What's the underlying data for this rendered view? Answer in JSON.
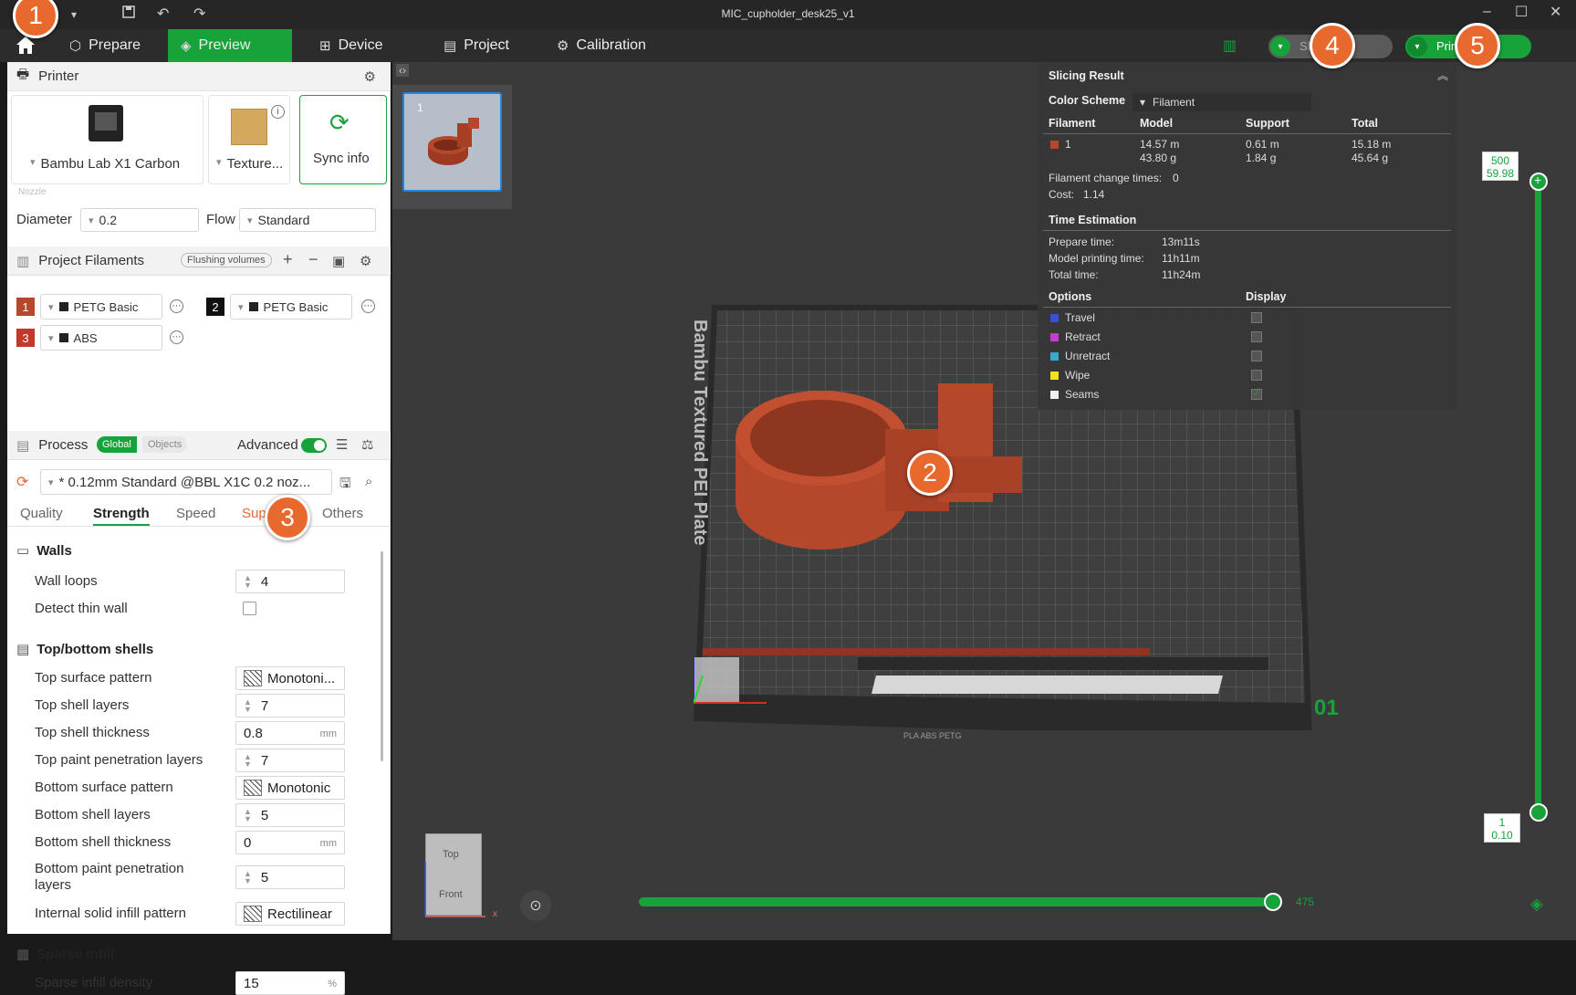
{
  "window": {
    "title": "MIC_cupholder_desk25_v1"
  },
  "nav": {
    "tabs": [
      {
        "label": "Prepare",
        "icon": "cube-icon"
      },
      {
        "label": "Preview",
        "icon": "layers-icon",
        "active": true
      },
      {
        "label": "Device",
        "icon": "device-icon"
      },
      {
        "label": "Project",
        "icon": "project-icon"
      },
      {
        "label": "Calibration",
        "icon": "calibration-icon"
      }
    ],
    "slice_label": "Slice plate",
    "print_label": "Print plate"
  },
  "printer": {
    "section_title": "Printer",
    "model": "Bambu Lab X1 Carbon",
    "plate": "Texture...",
    "sync_label": "Sync info",
    "nozzle_caption": "Nozzle",
    "diameter_label": "Diameter",
    "diameter_value": "0.2",
    "flow_label": "Flow",
    "flow_value": "Standard"
  },
  "filaments": {
    "section_title": "Project Filaments",
    "flushing_label": "Flushing volumes",
    "items": [
      {
        "index": "1",
        "name": "PETG Basic",
        "color": "#b5472a"
      },
      {
        "index": "2",
        "name": "PETG Basic",
        "color": "#111111"
      },
      {
        "index": "3",
        "name": "ABS",
        "color": "#c0392b"
      }
    ]
  },
  "process": {
    "section_title": "Process",
    "global_label": "Global",
    "objects_label": "Objects",
    "advanced_label": "Advanced",
    "preset": "* 0.12mm Standard @BBL X1C 0.2 noz...",
    "tabs": [
      "Quality",
      "Strength",
      "Speed",
      "Support",
      "Others"
    ],
    "active_tab": "Strength",
    "walls": {
      "title": "Walls",
      "wall_loops_label": "Wall loops",
      "wall_loops": "4",
      "detect_thin_wall_label": "Detect thin wall"
    },
    "shells": {
      "title": "Top/bottom shells",
      "rows": [
        {
          "label": "Top surface pattern",
          "value": "Monotoni...",
          "kind": "pattern"
        },
        {
          "label": "Top shell layers",
          "value": "7",
          "kind": "spin"
        },
        {
          "label": "Top shell thickness",
          "value": "0.8",
          "kind": "unit",
          "unit": "mm"
        },
        {
          "label": "Top paint penetration layers",
          "value": "7",
          "kind": "spin"
        },
        {
          "label": "Bottom surface pattern",
          "value": "Monotonic",
          "kind": "pattern"
        },
        {
          "label": "Bottom shell layers",
          "value": "5",
          "kind": "spin"
        },
        {
          "label": "Bottom shell thickness",
          "value": "0",
          "kind": "unit",
          "unit": "mm"
        },
        {
          "label": "Bottom paint penetration layers",
          "value": "5",
          "kind": "spin"
        },
        {
          "label": "Internal solid infill pattern",
          "value": "Rectilinear",
          "kind": "pattern"
        }
      ]
    },
    "infill": {
      "title": "Sparse infill",
      "density_label": "Sparse infill density",
      "density_value": "15",
      "density_unit": "%"
    }
  },
  "viewport": {
    "plate_number": "1",
    "bed_label": "Bambu Textured PEI Plate",
    "plate_id": "01",
    "bed_strip_text": "PLA ABS PETG",
    "view_top": "Top",
    "view_front": "Front",
    "axis_x": "x",
    "layer_top": "500",
    "height_top": "59.98",
    "layer_bottom": "1",
    "height_bottom": "0.10",
    "move_value": "475"
  },
  "slicing_result": {
    "title": "Slicing Result",
    "color_scheme_label": "Color Scheme",
    "color_scheme_value": "Filament",
    "headers": [
      "Filament",
      "Model",
      "Support",
      "Total"
    ],
    "row": {
      "filament": "1",
      "model_len": "14.57 m",
      "model_g": "43.80 g",
      "support_len": "0.61 m",
      "support_g": "1.84 g",
      "total_len": "15.18 m",
      "total_g": "45.64 g",
      "color": "#b5472a"
    },
    "change_times_label": "Filament change times:",
    "change_times": "0",
    "cost_label": "Cost:",
    "cost": "1.14",
    "time_title": "Time Estimation",
    "prepare_label": "Prepare time:",
    "prepare": "13m11s",
    "model_time_label": "Model printing time:",
    "model_time": "11h11m",
    "total_label": "Total time:",
    "total": "11h24m",
    "options_label": "Options",
    "display_label": "Display",
    "options": [
      {
        "name": "Travel",
        "color": "#3a4fd1",
        "checked": false
      },
      {
        "name": "Retract",
        "color": "#c53ad1",
        "checked": false
      },
      {
        "name": "Unretract",
        "color": "#3aa8d1",
        "checked": false
      },
      {
        "name": "Wipe",
        "color": "#f2e21c",
        "checked": false
      },
      {
        "name": "Seams",
        "color": "#f0f0f0",
        "checked": true
      }
    ]
  },
  "callouts": [
    "1",
    "2",
    "3",
    "4",
    "5"
  ]
}
